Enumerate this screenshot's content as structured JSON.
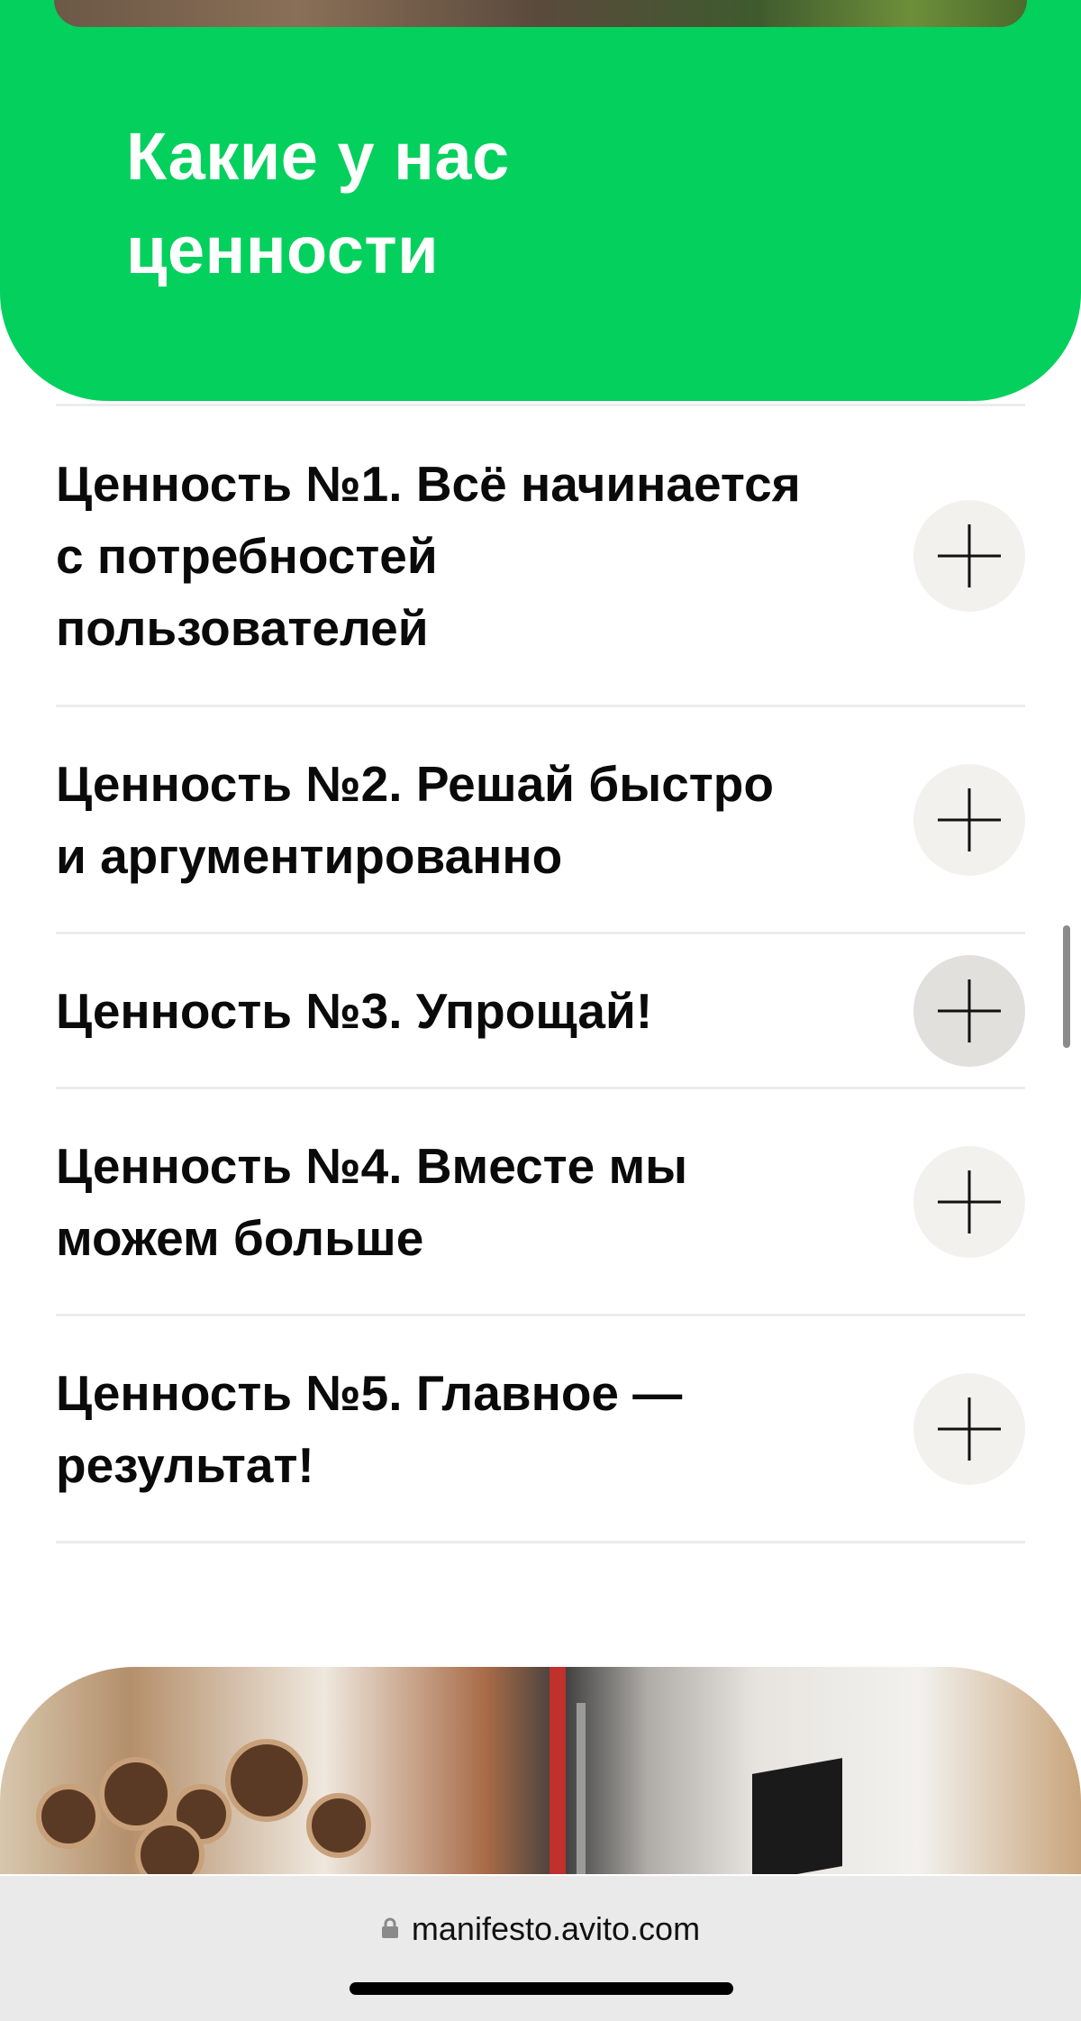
{
  "hero": {
    "title_line1": "Какие у нас",
    "title_line2": "ценности"
  },
  "values": [
    {
      "title_lines": [
        "Ценность №1. Всё начинается",
        "с потребностей",
        "пользователей"
      ]
    },
    {
      "title_lines": [
        "Ценность №2. Решай быстро",
        "и аргументированно"
      ]
    },
    {
      "title_lines": [
        "Ценность №3. Упрощай!"
      ]
    },
    {
      "title_lines": [
        "Ценность №4. Вместе мы",
        "можем больше"
      ]
    },
    {
      "title_lines": [
        "Ценность №5. Главное —",
        "результат!"
      ]
    }
  ],
  "icons": {
    "expand": "plus-icon",
    "secure": "lock-icon"
  },
  "colors": {
    "brand_green": "#04d05d",
    "button_bg": "#f3f1ed",
    "button_active_bg": "#e1e0dd"
  },
  "browser": {
    "url": "manifesto.avito.com"
  }
}
